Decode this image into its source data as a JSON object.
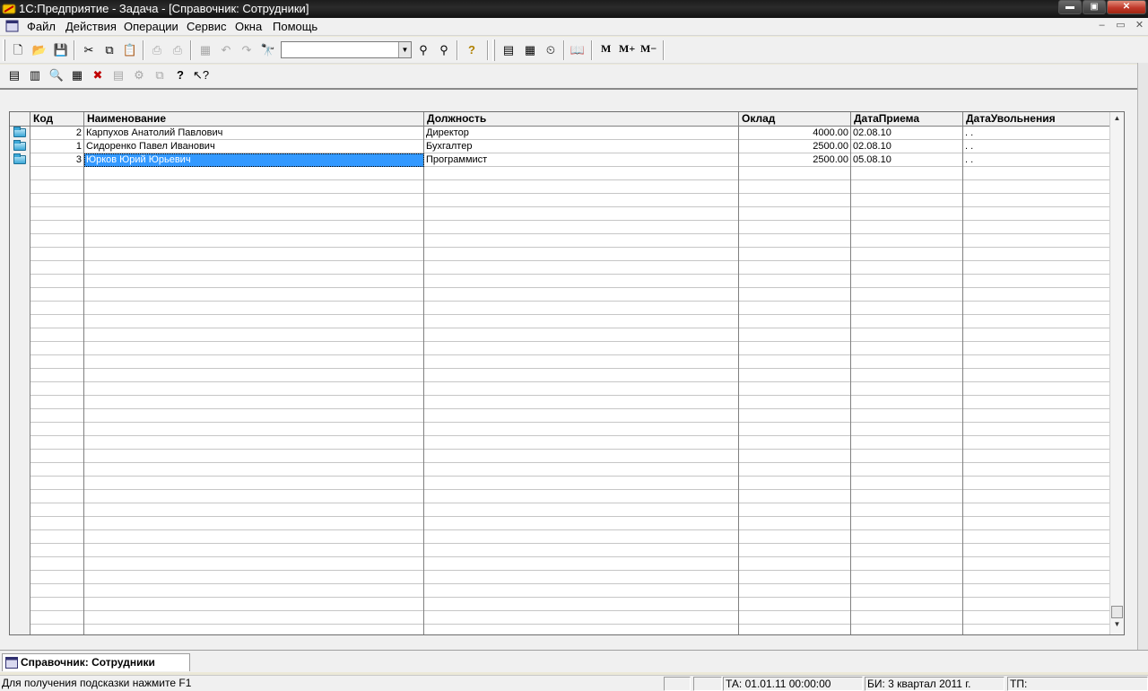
{
  "window": {
    "title": "1С:Предприятие - Задача - [Справочник: Сотрудники]",
    "controls": {
      "minimize": "▬",
      "restore": "▣",
      "close": "✕"
    }
  },
  "menu": {
    "items": [
      "Файл",
      "Действия",
      "Операции",
      "Сервис",
      "Окна",
      "Помощь"
    ],
    "mdi_controls": [
      "–",
      "▭",
      "✕"
    ]
  },
  "toolbar1": {
    "icons": [
      "new-icon",
      "open-icon",
      "save-icon",
      "cut-icon",
      "copy-icon",
      "paste-icon",
      "print-icon",
      "print-preview-icon",
      "properties-icon",
      "undo-icon",
      "redo-icon",
      "find-icon",
      "find-next-icon",
      "find-prev-icon",
      "help-icon",
      "calculator-icon",
      "calendar-icon",
      "timer-icon",
      "book-icon"
    ],
    "search_value": "",
    "memory_buttons": [
      "M",
      "M+",
      "M−"
    ]
  },
  "toolbar2": {
    "icons": [
      "new-row-icon",
      "new-group-icon",
      "view-icon",
      "edit-icon",
      "delete-icon",
      "mark-delete-icon",
      "hierarchy-icon",
      "copy-row-icon",
      "help-doc-icon",
      "whats-this-icon"
    ]
  },
  "table": {
    "columns": [
      "",
      "Код",
      "Наименование",
      "Должность",
      "Оклад",
      "ДатаПриема",
      "ДатаУвольнения"
    ],
    "rows": [
      {
        "code": "2",
        "name": "Карпухов Анатолий Павлович",
        "position": "Директор",
        "salary": "4000.00",
        "hired": "02.08.10",
        "fired": " .  ."
      },
      {
        "code": "1",
        "name": "Сидоренко Павел Иванович",
        "position": "Бухгалтер",
        "salary": "2500.00",
        "hired": "02.08.10",
        "fired": " .  ."
      },
      {
        "code": "3",
        "name": "Юрков Юрий Юрьевич",
        "position": "Программист",
        "salary": "2500.00",
        "hired": "05.08.10",
        "fired": " .  ."
      }
    ],
    "selected_row": 2
  },
  "window_tab": {
    "label": "Справочник: Сотрудники"
  },
  "status": {
    "hint": "Для получения подсказки нажмите F1",
    "ta": "ТА: 01.01.11  00:00:00",
    "bi": "БИ: 3 квартал 2011 г.",
    "tp": "ТП:"
  },
  "colors": {
    "selection": "#3399ff",
    "titlebar": "#1c1c1c"
  }
}
